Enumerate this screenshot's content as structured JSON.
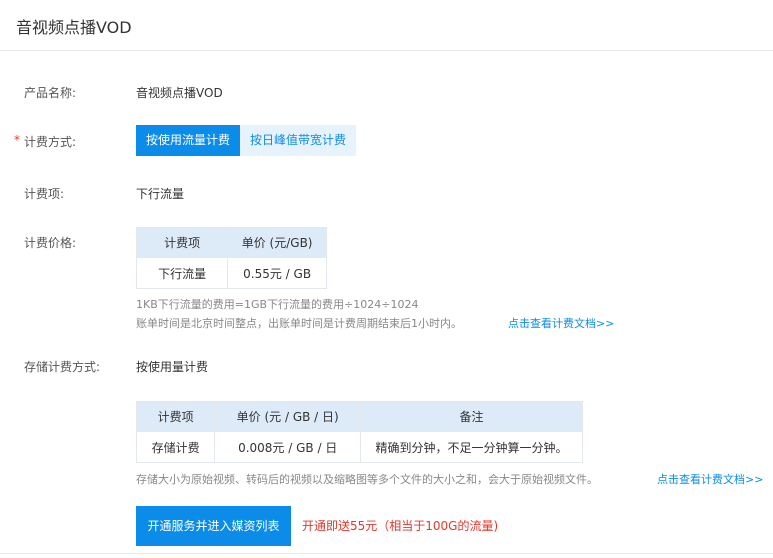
{
  "header": {
    "title": "音视频点播VOD"
  },
  "product": {
    "label": "产品名称:",
    "value": "音视频点播VOD"
  },
  "billing_method": {
    "required_mark": "*",
    "label": "计费方式:",
    "options": [
      "按使用流量计费",
      "按日峰值带宽计费"
    ],
    "selected": "按使用流量计费"
  },
  "billing_item": {
    "label": "计费项:",
    "value": "下行流量"
  },
  "billing_price": {
    "label": "计费价格:",
    "table": {
      "headers": [
        "计费项",
        "单价 (元/GB)"
      ],
      "rows": [
        [
          "下行流量",
          "0.55元 / GB"
        ]
      ]
    },
    "note_line1": "1KB下行流量的费用=1GB下行流量的费用÷1024÷1024",
    "note_line2": "账单时间是北京时间整点，出账单时间是计费周期结束后1小时内。",
    "doc_link": "点击查看计费文档>>"
  },
  "storage": {
    "label": "存储计费方式:",
    "value": "按使用量计费",
    "table": {
      "headers": [
        "计费项",
        "单价 (元 / GB / 日)",
        "备注"
      ],
      "rows": [
        [
          "存储计费",
          "0.008元 / GB / 日",
          "精确到分钟，不足一分钟算一分钟。"
        ]
      ]
    },
    "note": "存储大小为原始视频、转码后的视频以及缩略图等多个文件的大小之和，会大于原始视频文件。",
    "doc_link": "点击查看计费文档>>"
  },
  "actions": {
    "open_button": "开通服务并进入媒资列表",
    "promo": "开通即送55元（相当于100G的流量)"
  },
  "colors": {
    "primary": "#0c8ce9",
    "danger": "#e0392e",
    "header_bg": "#ddeaf7"
  }
}
